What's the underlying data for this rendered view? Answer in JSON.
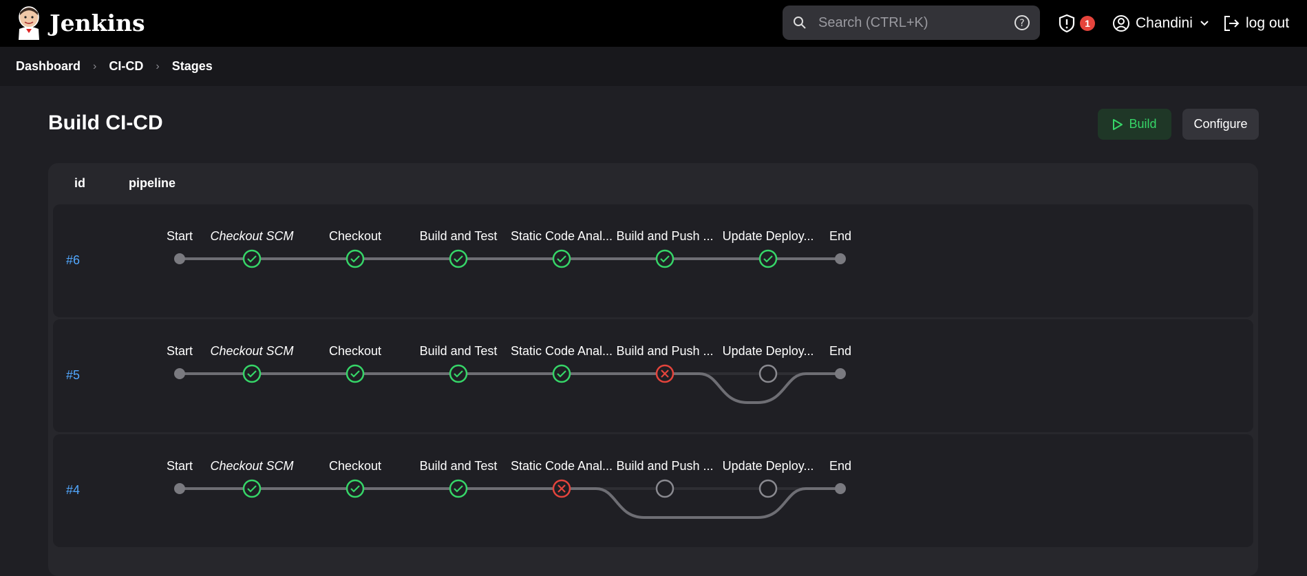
{
  "app": {
    "title": "Jenkins"
  },
  "search": {
    "placeholder": "Search (CTRL+K)"
  },
  "header": {
    "alerts_count": "1",
    "user": "Chandini",
    "logout_label": "log out"
  },
  "breadcrumb": [
    "Dashboard",
    "CI-CD",
    "Stages"
  ],
  "page": {
    "title": "Build CI-CD",
    "build_label": "Build",
    "configure_label": "Configure"
  },
  "table": {
    "columns": [
      "id",
      "pipeline"
    ]
  },
  "colors": {
    "success": "#36d668",
    "failure": "#e5443c",
    "pending": "#8a8a90",
    "link": "#52a8ff"
  },
  "stages": [
    "Start",
    "Checkout SCM",
    "Checkout",
    "Build and Test",
    "Static Code Anal...",
    "Build and Push ...",
    "Update Deploy...",
    "End"
  ],
  "runs": [
    {
      "id": "#6",
      "statuses": [
        "endpoint",
        "success",
        "success",
        "success",
        "success",
        "success",
        "success",
        "endpoint"
      ]
    },
    {
      "id": "#5",
      "statuses": [
        "endpoint",
        "success",
        "success",
        "success",
        "success",
        "failure",
        "skipped",
        "endpoint"
      ]
    },
    {
      "id": "#4",
      "statuses": [
        "endpoint",
        "success",
        "success",
        "success",
        "failure",
        "skipped",
        "skipped",
        "endpoint"
      ]
    }
  ]
}
